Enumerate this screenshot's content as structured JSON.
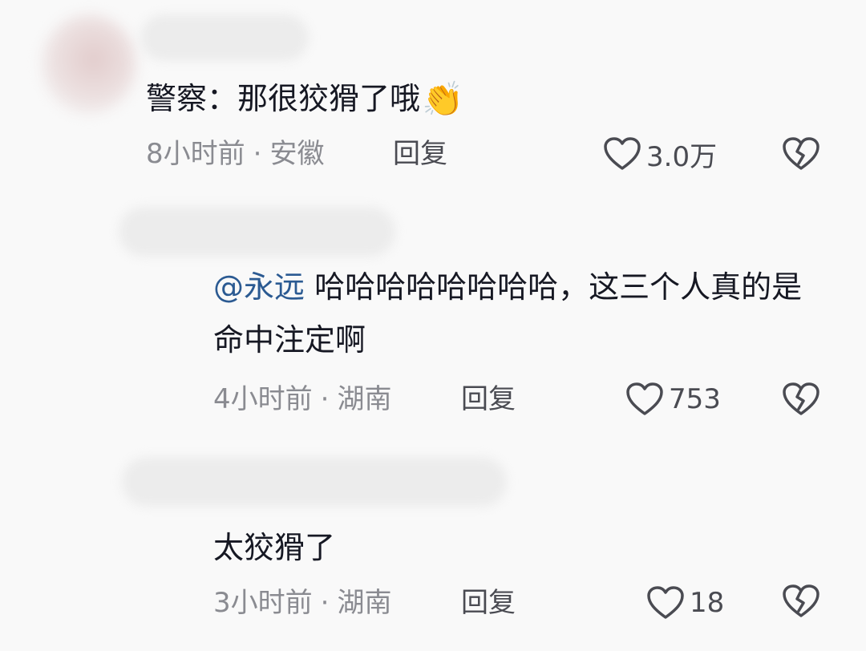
{
  "comments": [
    {
      "text": "警察：那很狡猾了哦",
      "emoji": "👏",
      "time": "8小时前",
      "location": "安徽",
      "reply_label": "回复",
      "likes": "3.0万"
    },
    {
      "mention": "@永远",
      "text": " 哈哈哈哈哈哈哈哈，这三个人真的是命中注定啊",
      "time": "4小时前",
      "location": "湖南",
      "reply_label": "回复",
      "likes": "753"
    },
    {
      "text": "太狡猾了",
      "time": "3小时前",
      "location": "湖南",
      "reply_label": "回复",
      "likes": "18"
    }
  ],
  "separator": "·",
  "colors": {
    "text": "#161823",
    "meta": "#8a8b91",
    "mention": "#2b5a92"
  },
  "icons": [
    "heart-icon",
    "broken-heart-icon",
    "clapping-hands-emoji"
  ]
}
